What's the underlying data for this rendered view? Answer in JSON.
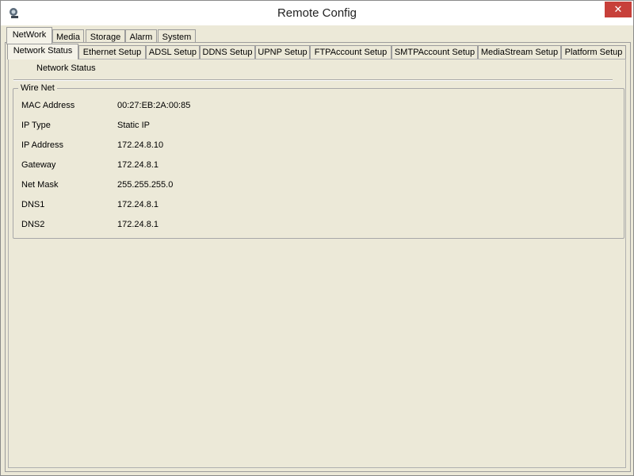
{
  "window": {
    "title": "Remote Config",
    "close_label": "✕"
  },
  "top_tabs": [
    "NetWork",
    "Media",
    "Storage",
    "Alarm",
    "System"
  ],
  "sub_tabs": [
    "Network Status",
    "Ethernet Setup",
    "ADSL Setup",
    "DDNS Setup",
    "UPNP Setup",
    "FTPAccount Setup",
    "SMTPAccount Setup",
    "MediaStream Setup",
    "Platform Setup"
  ],
  "panel": {
    "section_title": "Network Status",
    "group_title": "Wire Net",
    "rows": [
      {
        "label": "MAC Address",
        "value": "00:27:EB:2A:00:85"
      },
      {
        "label": "IP Type",
        "value": "Static IP"
      },
      {
        "label": "IP Address",
        "value": "172.24.8.10"
      },
      {
        "label": "Gateway",
        "value": "172.24.8.1"
      },
      {
        "label": "Net Mask",
        "value": "255.255.255.0"
      },
      {
        "label": "DNS1",
        "value": "172.24.8.1"
      },
      {
        "label": "DNS2",
        "value": "172.24.8.1"
      }
    ]
  },
  "colors": {
    "window_bg": "#ece9d8",
    "close_button": "#c7403a"
  },
  "icons": {
    "app": "camera-icon",
    "close": "close-icon"
  }
}
